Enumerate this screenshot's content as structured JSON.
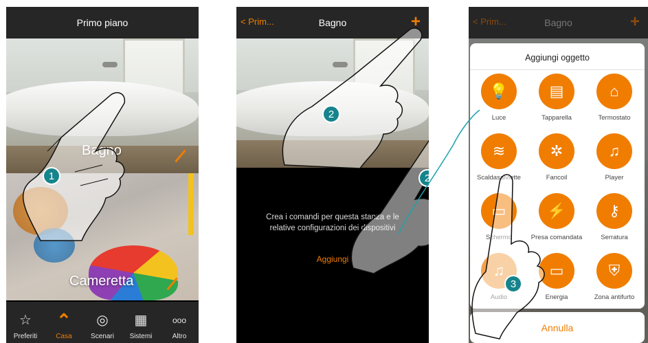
{
  "phone1": {
    "title": "Primo piano",
    "rooms": [
      {
        "label": "Bagno"
      },
      {
        "label": "Cameretta"
      }
    ],
    "tabs": [
      {
        "label": "Preferiti",
        "icon": "star-icon",
        "glyph": "☆",
        "active": false
      },
      {
        "label": "Casa",
        "icon": "home-icon",
        "glyph": "⌃",
        "active": true
      },
      {
        "label": "Scenari",
        "icon": "scenario-icon",
        "glyph": "◎",
        "active": false
      },
      {
        "label": "Sistemi",
        "icon": "grid-icon",
        "glyph": "▦",
        "active": false
      },
      {
        "label": "Altro",
        "icon": "more-icon",
        "glyph": "ooo",
        "active": false
      }
    ],
    "callout": "1"
  },
  "phone2": {
    "back_label": "Prim...",
    "title": "Bagno",
    "add_glyph": "+",
    "empty_text": "Crea i comandi per questa stanza e le relative configurazioni dei dispositivi",
    "add_link": "Aggiungi",
    "callout_a": "2",
    "callout_b": "2"
  },
  "phone3": {
    "back_label": "Prim...",
    "title": "Bagno",
    "add_glyph": "+",
    "sheet_title": "Aggiungi oggetto",
    "items": [
      {
        "label": "Luce",
        "icon": "bulb-icon",
        "glyph": "💡"
      },
      {
        "label": "Tapparella",
        "icon": "shutter-icon",
        "glyph": "▤"
      },
      {
        "label": "Termostato",
        "icon": "thermostat-icon",
        "glyph": "⌂"
      },
      {
        "label": "Scaldasalviette",
        "icon": "towel-heater-icon",
        "glyph": "≋"
      },
      {
        "label": "Fancoil",
        "icon": "fan-icon",
        "glyph": "✲"
      },
      {
        "label": "Player",
        "icon": "music-note-icon",
        "glyph": "♫"
      },
      {
        "label": "Schermo",
        "icon": "screen-icon",
        "glyph": "▭"
      },
      {
        "label": "Presa comandata",
        "icon": "plug-icon",
        "glyph": "⚡"
      },
      {
        "label": "Serratura",
        "icon": "key-icon",
        "glyph": "⚷"
      },
      {
        "label": "Audio",
        "icon": "audio-icon",
        "glyph": "♫"
      },
      {
        "label": "Energia",
        "icon": "battery-icon",
        "glyph": "▭"
      },
      {
        "label": "Zona antifurto",
        "icon": "shield-icon",
        "glyph": "⛨"
      }
    ],
    "cancel_label": "Annulla",
    "callout": "3"
  },
  "colors": {
    "accent": "#f07d00",
    "bar": "#262626",
    "callout": "#16848c"
  }
}
